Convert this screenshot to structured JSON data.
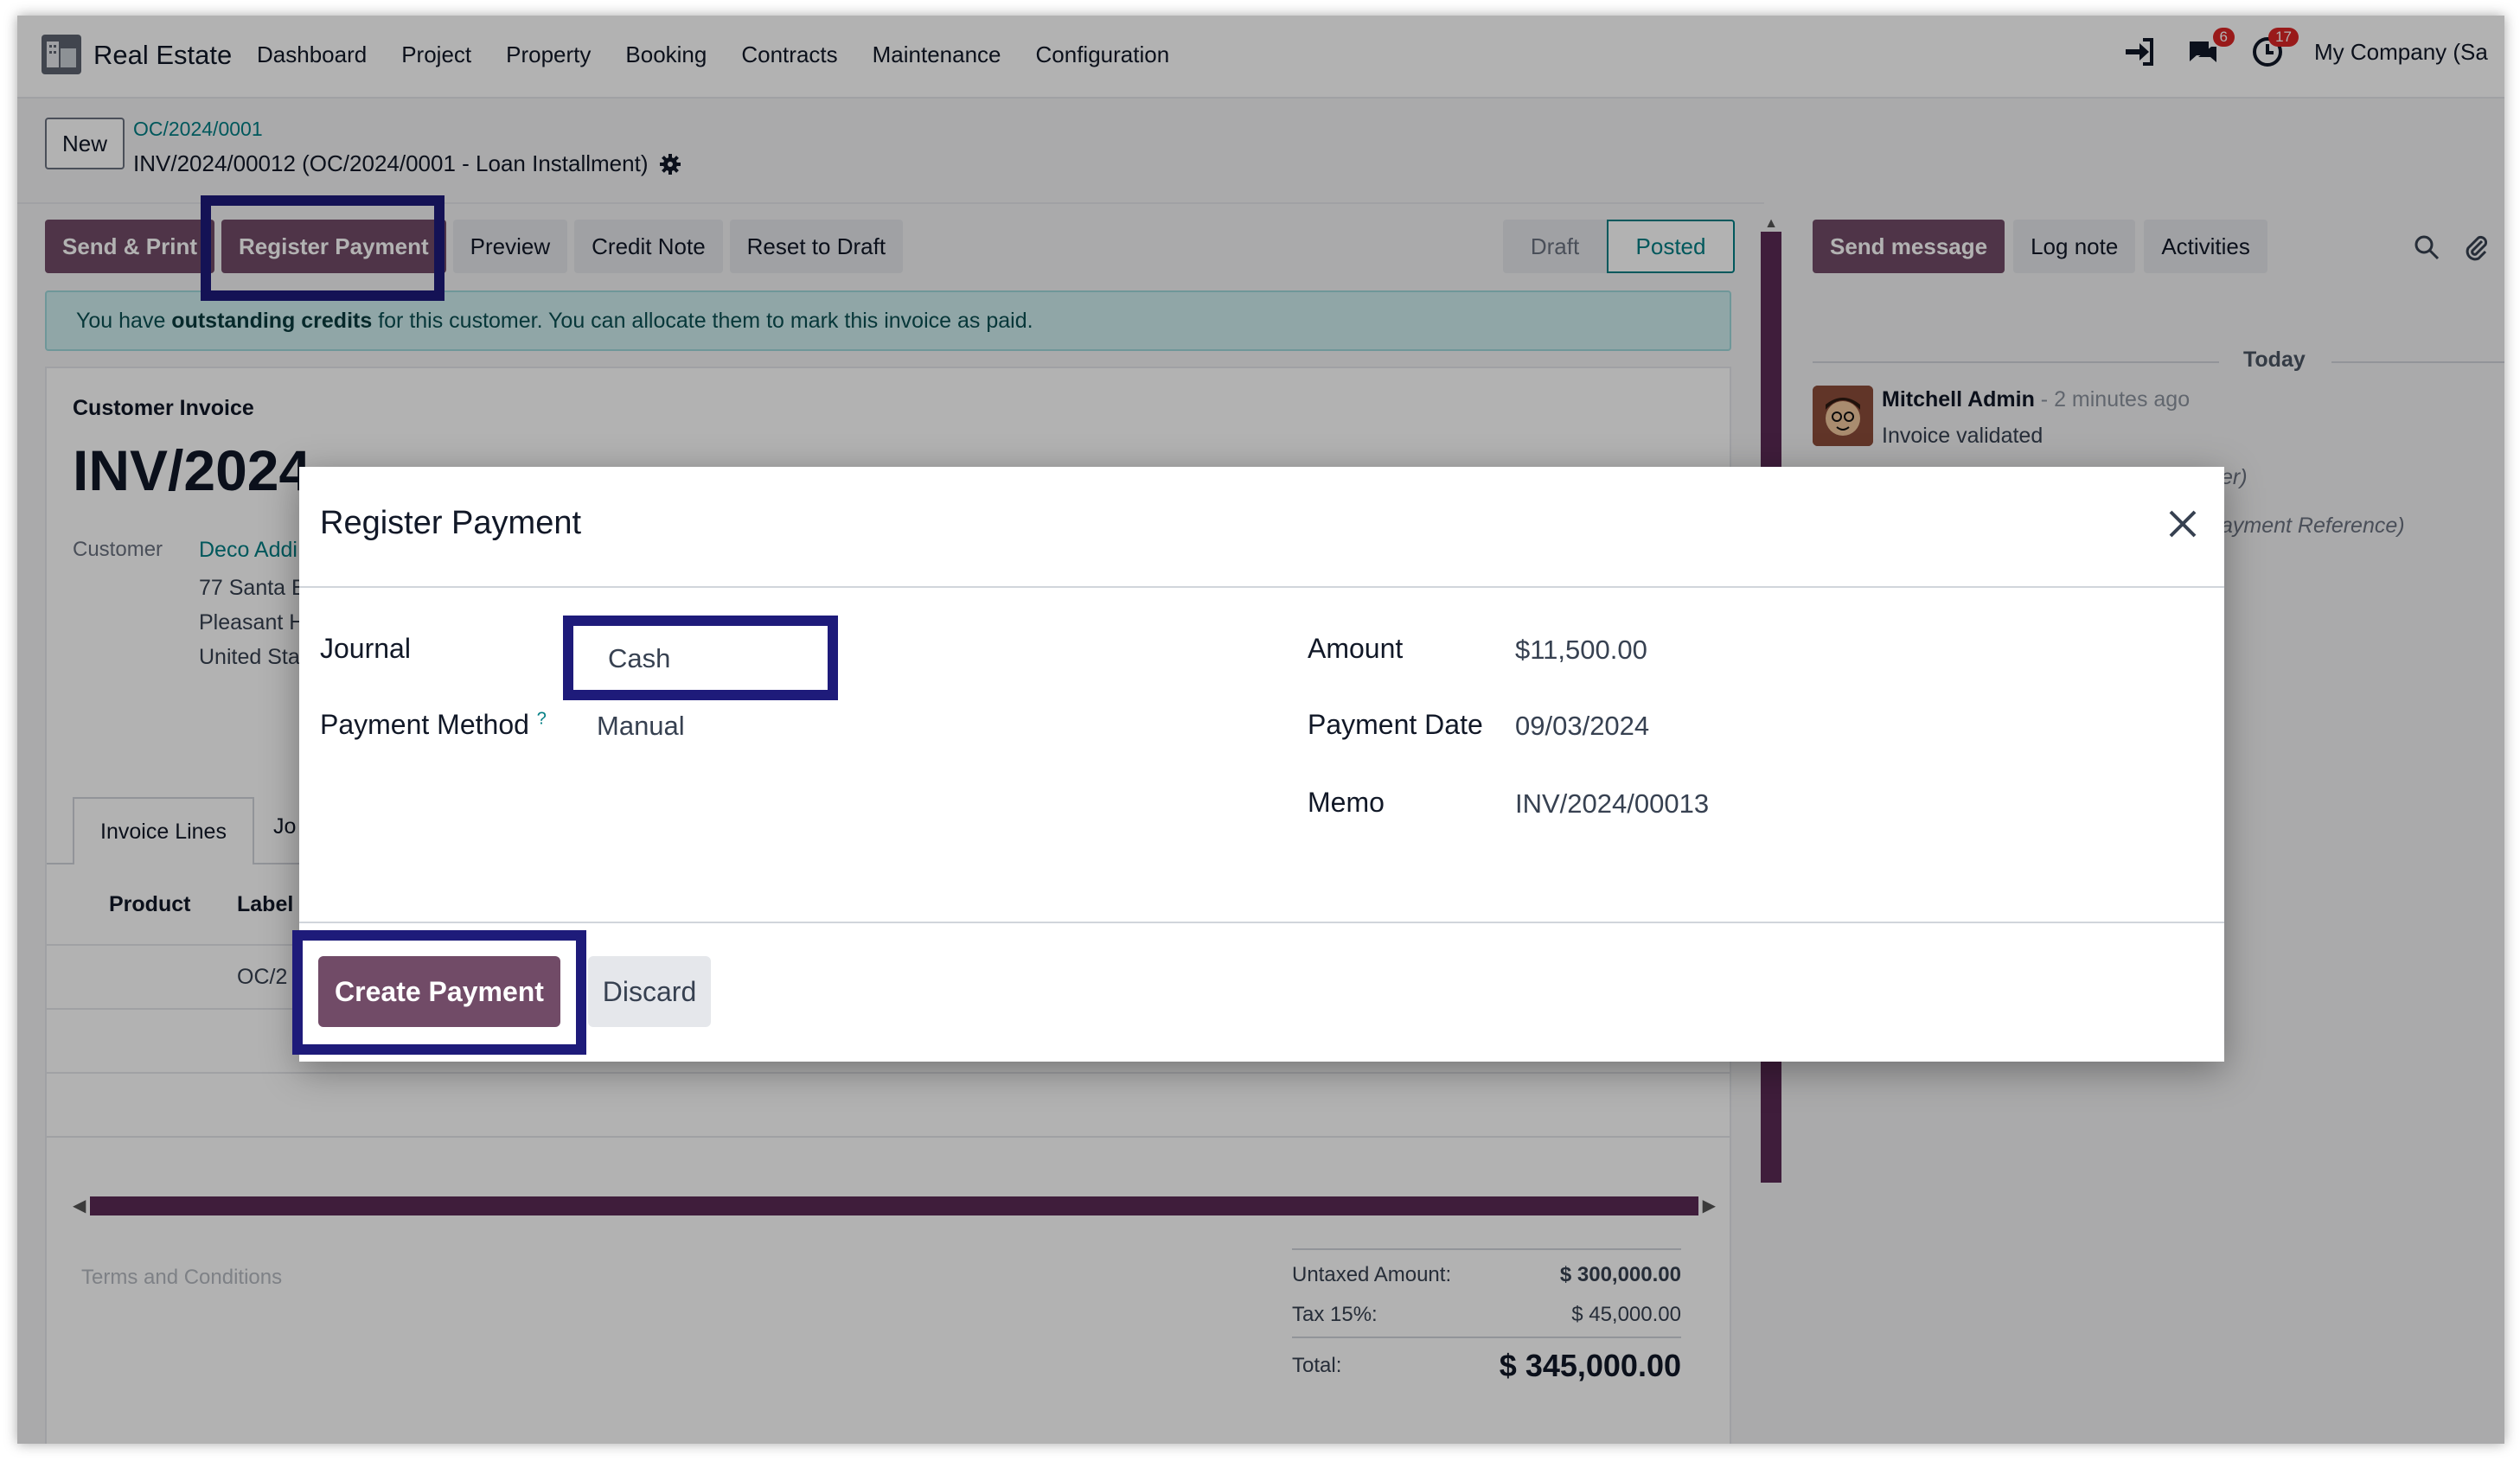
{
  "navbar": {
    "app_name": "Real Estate",
    "menu": [
      "Dashboard",
      "Project",
      "Property",
      "Booking",
      "Contracts",
      "Maintenance",
      "Configuration"
    ],
    "messages_badge": "6",
    "activities_badge": "17",
    "company": "My Company (Sa"
  },
  "breadcrumb": {
    "new_label": "New",
    "parent": "OC/2024/0001",
    "current": "INV/2024/00012 (OC/2024/0001 - Loan Installment)"
  },
  "actions": {
    "send_print": "Send & Print",
    "register_payment": "Register Payment",
    "preview": "Preview",
    "credit_note": "Credit Note",
    "reset_draft": "Reset to Draft"
  },
  "status": {
    "draft": "Draft",
    "posted": "Posted"
  },
  "alert": {
    "prefix": "You have ",
    "bold": "outstanding credits",
    "suffix": " for this customer. You can allocate them to mark this invoice as paid."
  },
  "form": {
    "type_label": "Customer Invoice",
    "number": "INV/2024",
    "customer_label": "Customer",
    "customer_name": "Deco Addi",
    "address": [
      "77 Santa B",
      "Pleasant H",
      "United Sta"
    ],
    "tabs": [
      "Invoice Lines",
      "Jo"
    ],
    "columns": [
      "Product",
      "Label"
    ],
    "row_label": "OC/2",
    "terms_placeholder": "Terms and Conditions",
    "totals": {
      "untaxed_label": "Untaxed Amount:",
      "untaxed_value": "$ 300,000.00",
      "tax_label": "Tax 15%:",
      "tax_value": "$ 45,000.00",
      "total_label": "Total:",
      "total_value": "$ 345,000.00"
    }
  },
  "chatter": {
    "send_message": "Send message",
    "log_note": "Log note",
    "activities": "Activities",
    "today": "Today",
    "author": "Mitchell Admin",
    "time": " - 2 minutes ago",
    "body": "Invoice validated",
    "frag1": "er)",
    "frag2": "ayment Reference)"
  },
  "modal": {
    "title": "Register Payment",
    "journal_label": "Journal",
    "journal_value": "Cash",
    "method_label": "Payment Method",
    "method_help": "?",
    "method_value": "Manual",
    "amount_label": "Amount",
    "amount_value": "$11,500.00",
    "date_label": "Payment Date",
    "date_value": "09/03/2024",
    "memo_label": "Memo",
    "memo_value": "INV/2024/00013",
    "create_label": "Create Payment",
    "discard_label": "Discard"
  },
  "colors": {
    "primary": "#714b67",
    "accent_teal": "#017e84",
    "highlight": "#1e1b7a"
  },
  "icons": [
    "app-logo-icon",
    "sign-in-icon",
    "messages-icon",
    "clock-icon",
    "gear-icon",
    "search-icon",
    "paperclip-icon",
    "close-icon"
  ]
}
